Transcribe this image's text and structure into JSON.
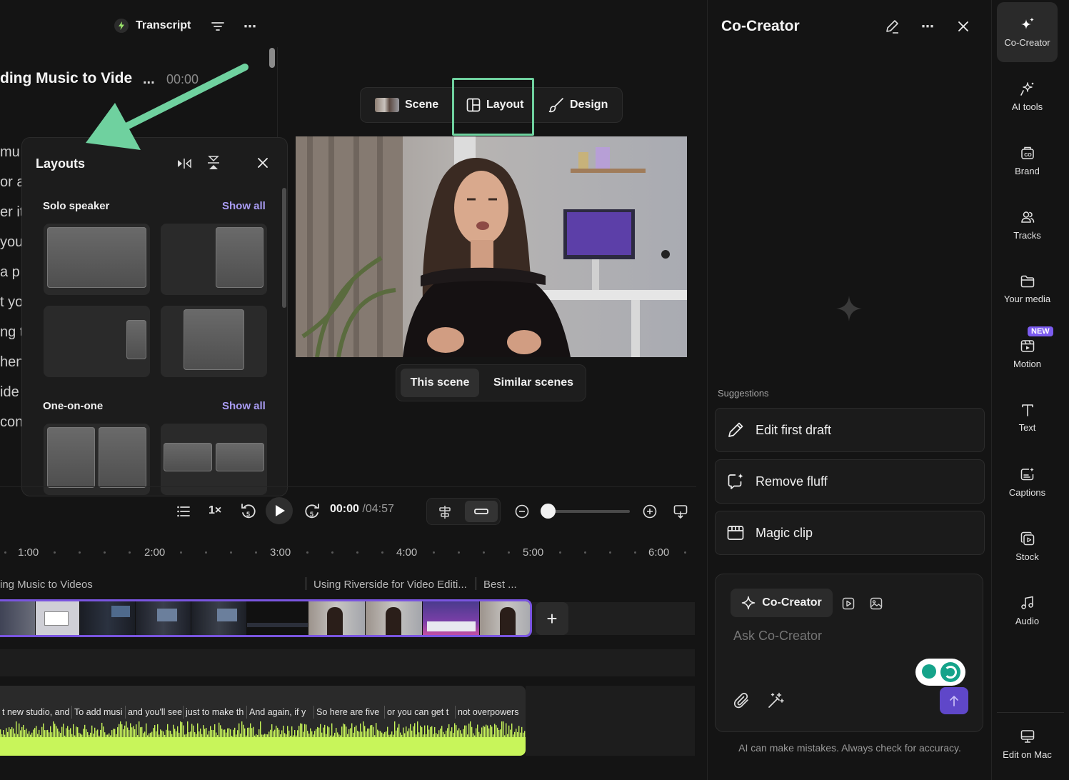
{
  "transcript": {
    "title": "Transcript",
    "document_title": "ding Music to Vide",
    "more": "...",
    "timestamp": "00:00",
    "lines": [
      "mu",
      "or a",
      "er it",
      "you",
      "a p",
      "t yo",
      "ng t",
      "hen",
      "ide",
      "con"
    ]
  },
  "layouts_panel": {
    "title": "Layouts",
    "sections": [
      {
        "name": "Solo speaker",
        "show_all": "Show all"
      },
      {
        "name": "One-on-one",
        "show_all": "Show all"
      }
    ]
  },
  "view_tabs": [
    {
      "label": "Scene",
      "icon": "scene-thumbnail"
    },
    {
      "label": "Layout",
      "icon": "layout-icon"
    },
    {
      "label": "Design",
      "icon": "brush-icon"
    }
  ],
  "scene_switch": {
    "this_scene": "This scene",
    "similar_scenes": "Similar scenes"
  },
  "playback": {
    "current": "00:00",
    "total": "/04:57",
    "speed": "1×"
  },
  "ruler": [
    "1:00",
    "2:00",
    "3:00",
    "4:00",
    "5:00",
    "6:00"
  ],
  "chapters": [
    "ing Music to Videos",
    "Using Riverside for Video Editi...",
    "Best ..."
  ],
  "captions": [
    "t new studio, and",
    "To add musi",
    "and you'll see",
    "just to make th",
    "And again, if y",
    "So here are five",
    "or you can get t",
    "not overpowers"
  ],
  "co_creator": {
    "title": "Co-Creator",
    "suggestions_label": "Suggestions",
    "suggestions": [
      {
        "label": "Edit first draft",
        "icon": "pencil-icon"
      },
      {
        "label": "Remove fluff",
        "icon": "sparkle-chat-icon"
      },
      {
        "label": "Magic clip",
        "icon": "calendar-clip-icon"
      }
    ],
    "mode_label": "Co-Creator",
    "input_placeholder": "Ask Co-Creator",
    "disclaimer": "AI can make mistakes. Always check for accuracy."
  },
  "side_nav": {
    "items": [
      {
        "label": "Co-Creator",
        "icon": "sparkle-icon",
        "active": true
      },
      {
        "label": "AI tools",
        "icon": "ai-tools-icon"
      },
      {
        "label": "Brand",
        "icon": "brand-icon"
      },
      {
        "label": "Tracks",
        "icon": "tracks-icon"
      },
      {
        "label": "Your media",
        "icon": "folder-icon"
      },
      {
        "label": "Motion",
        "icon": "motion-icon",
        "badge": "NEW"
      },
      {
        "label": "Text",
        "icon": "text-icon"
      },
      {
        "label": "Captions",
        "icon": "captions-icon"
      },
      {
        "label": "Stock",
        "icon": "stock-icon"
      },
      {
        "label": "Audio",
        "icon": "music-icon"
      }
    ],
    "bottom": {
      "label": "Edit on Mac",
      "icon": "monitor-icon"
    }
  },
  "colors": {
    "accent": "#7a55e0",
    "highlight": "#6fd19f",
    "waveform": "#c8f55a",
    "link": "#a99cf3"
  }
}
